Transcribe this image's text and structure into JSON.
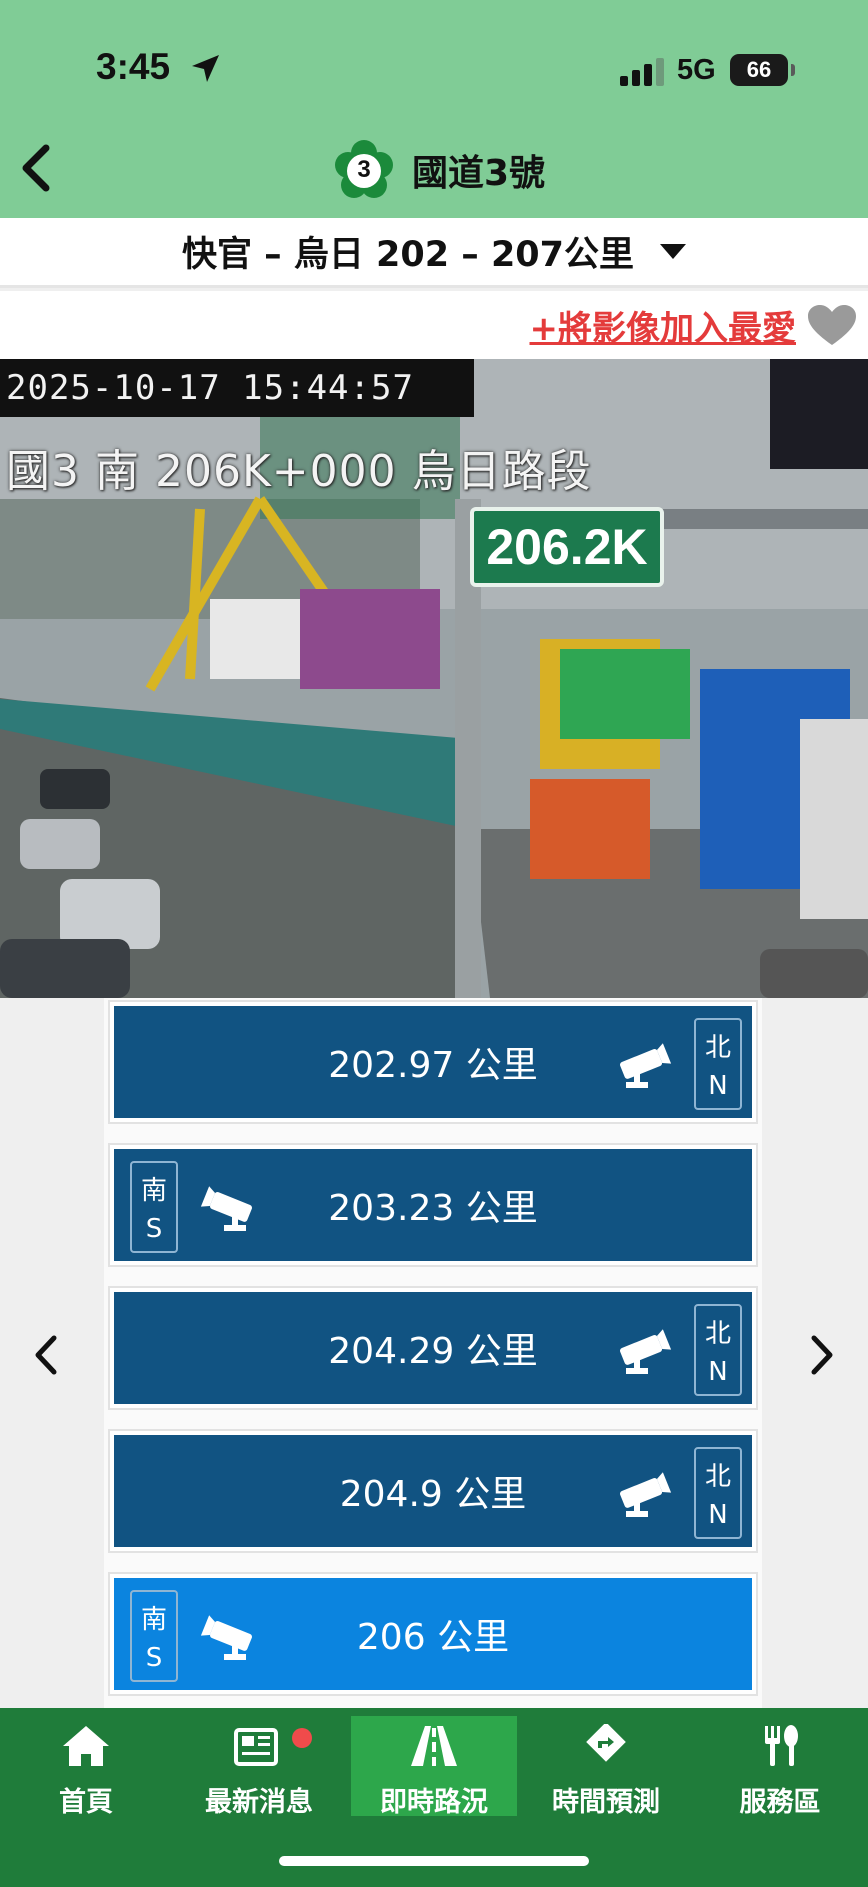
{
  "status_bar": {
    "time": "3:45",
    "network": "5G",
    "battery": "66"
  },
  "header": {
    "route_number": "3",
    "title": "國道3號"
  },
  "section_selector": {
    "label": "快官 – 烏日 202 – 207公里"
  },
  "favorite": {
    "label": "+將影像加入最愛"
  },
  "camera_image": {
    "timestamp": "2025-10-17 15:44:57",
    "caption": "國3 南 206K+000 烏日路段",
    "km_sign": "206.2K"
  },
  "camera_list": [
    {
      "km_label": "202.97 公里",
      "dir_zh": "北",
      "dir_en": "N",
      "active": false
    },
    {
      "km_label": "203.23 公里",
      "dir_zh": "南",
      "dir_en": "S",
      "active": false
    },
    {
      "km_label": "204.29 公里",
      "dir_zh": "北",
      "dir_en": "N",
      "active": false
    },
    {
      "km_label": "204.9 公里",
      "dir_zh": "北",
      "dir_en": "N",
      "active": false
    },
    {
      "km_label": "206 公里",
      "dir_zh": "南",
      "dir_en": "S",
      "active": true
    }
  ],
  "bottom_nav": [
    {
      "label": "首頁",
      "icon": "home-icon"
    },
    {
      "label": "最新消息",
      "icon": "news-icon"
    },
    {
      "label": "即時路況",
      "icon": "road-icon"
    },
    {
      "label": "時間預測",
      "icon": "route-sign-icon"
    },
    {
      "label": "服務區",
      "icon": "utensils-icon"
    }
  ],
  "colors": {
    "header_green": "#80cc96",
    "list_item": "#115382",
    "list_item_active": "#0b84df",
    "nav_green": "#1f7c3a",
    "nav_active": "#2da74b",
    "favorite_red": "#e43b3b"
  }
}
